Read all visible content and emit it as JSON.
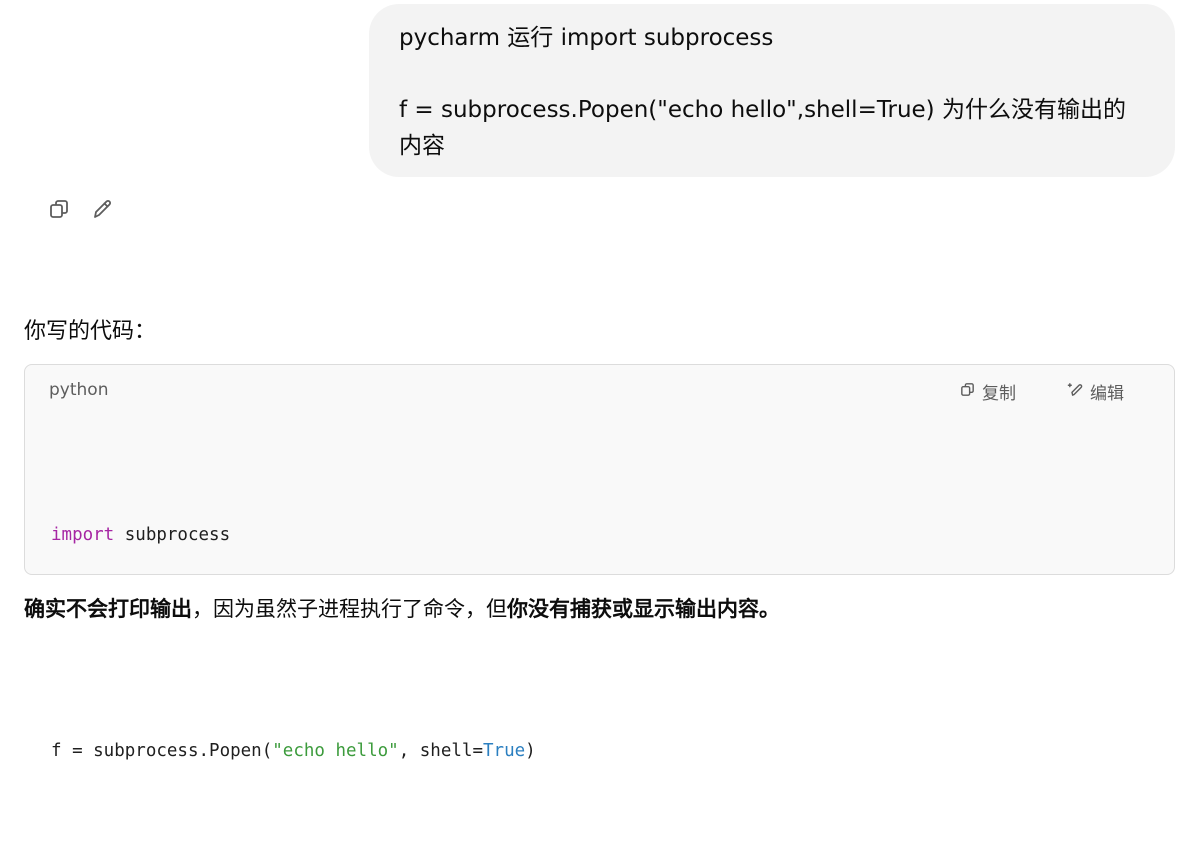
{
  "user_message": {
    "line1": "pycharm 运行 import subprocess",
    "line2": "f = subprocess.Popen(\"echo hello\",shell=True) 为什么没有输出的",
    "line3": "内容"
  },
  "message_actions": {
    "copy_icon": "copy-icon",
    "edit_icon": "pencil-icon"
  },
  "response": {
    "intro": "你写的代码：",
    "code_block": {
      "language": "python",
      "copy_label": "复制",
      "edit_label": "编辑",
      "lines": [
        {
          "kw": "import",
          "rest": " subprocess"
        },
        {
          "prefix": "f = subprocess.Popen(",
          "str": "\"echo hello\"",
          "mid": ", shell=",
          "bool": "True",
          "suffix": ")"
        }
      ]
    },
    "bottom": {
      "bold1": "确实不会打印输出",
      "normal": "，因为虽然子进程执行了命令，但",
      "bold2": "你没有捕获或显示输出内容。"
    }
  },
  "colors": {
    "bubble": "#f3f3f3",
    "keyword": "#a626a4",
    "string": "#3c9b3c",
    "boolean": "#2b7fc0"
  }
}
